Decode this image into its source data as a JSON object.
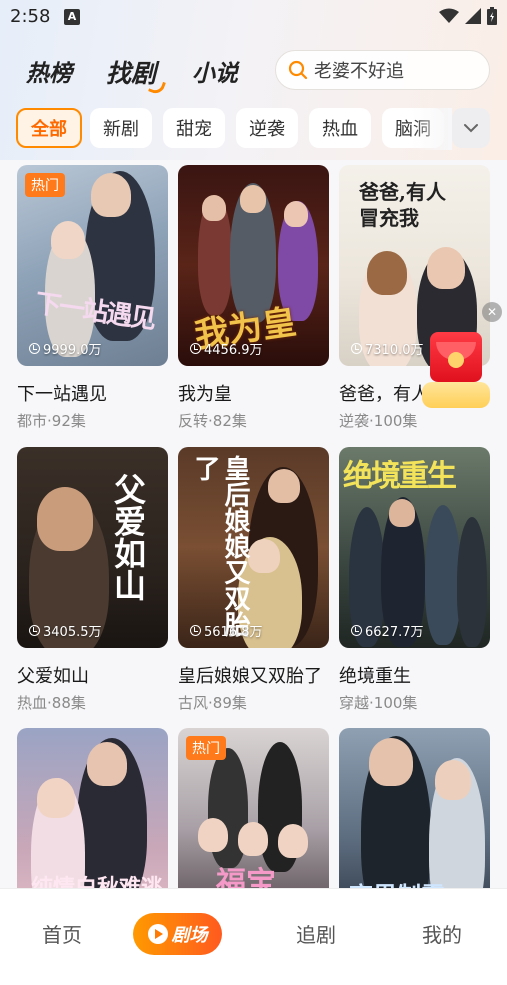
{
  "status": {
    "time": "2:58",
    "a_badge": "A"
  },
  "top_nav": {
    "tabs": [
      {
        "label": "热榜",
        "active": false
      },
      {
        "label": "找剧",
        "active": true
      },
      {
        "label": "小说",
        "active": false
      }
    ],
    "search_placeholder": "老婆不好追"
  },
  "chips": [
    {
      "label": "全部",
      "active": true
    },
    {
      "label": "新剧",
      "active": false
    },
    {
      "label": "甜宠",
      "active": false
    },
    {
      "label": "逆袭",
      "active": false
    },
    {
      "label": "热血",
      "active": false
    },
    {
      "label": "脑洞",
      "active": false
    }
  ],
  "cards": [
    {
      "title": "下一站遇见",
      "genre": "都市",
      "episodes": "92集",
      "views": "9999.0万",
      "badge": "热门",
      "poster_text": "下一站遇见"
    },
    {
      "title": "我为皇",
      "genre": "反转",
      "episodes": "82集",
      "views": "4456.9万",
      "badge": "",
      "poster_text": "我为皇"
    },
    {
      "title": "爸爸，有人冒充我",
      "genre": "逆袭",
      "episodes": "100集",
      "views": "7310.0万",
      "badge": "",
      "poster_text": "爸爸,有人冒充我"
    },
    {
      "title": "父爱如山",
      "genre": "热血",
      "episodes": "88集",
      "views": "3405.5万",
      "badge": "",
      "poster_text": "父爱如山"
    },
    {
      "title": "皇后娘娘又双胎了",
      "genre": "古风",
      "episodes": "89集",
      "views": "5616.8万",
      "badge": "",
      "poster_text": "皇后娘娘又双胎了"
    },
    {
      "title": "绝境重生",
      "genre": "穿越",
      "episodes": "100集",
      "views": "6627.7万",
      "badge": "",
      "poster_text": "绝境重生"
    },
    {
      "title": "",
      "genre": "",
      "episodes": "",
      "views": "",
      "badge": "",
      "poster_text": "纯情白秋难逃"
    },
    {
      "title": "",
      "genre": "",
      "episodes": "",
      "views": "",
      "badge": "热门",
      "poster_text": "福宝"
    },
    {
      "title": "",
      "genre": "",
      "episodes": "",
      "views": "",
      "badge": "",
      "poster_text": "商界制霸"
    }
  ],
  "bottom_nav": {
    "home": "首页",
    "theater": "剧场",
    "follow": "追剧",
    "mine": "我的"
  },
  "colors": {
    "accent": "#ff8a00",
    "badge": "#ff7a1a"
  }
}
